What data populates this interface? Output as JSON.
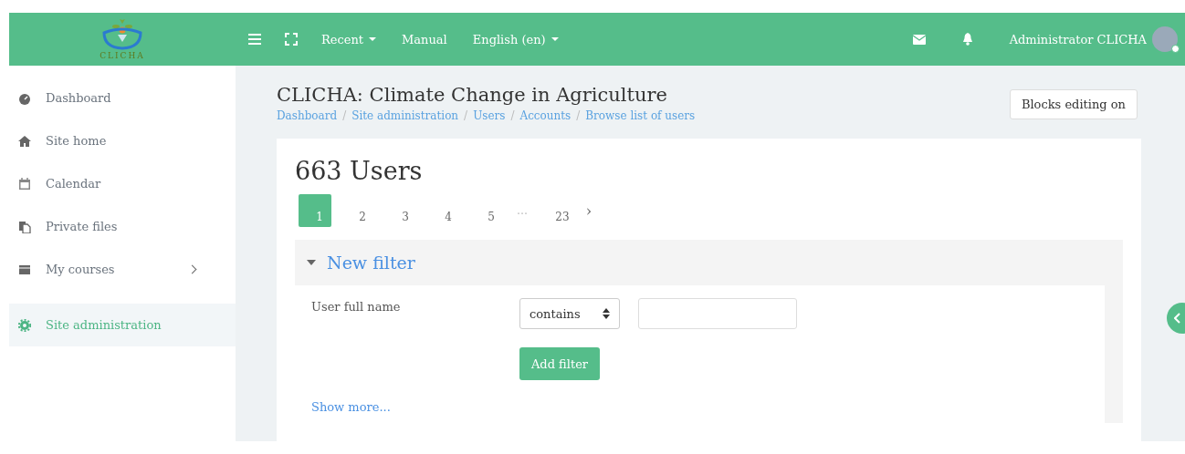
{
  "navbar": {
    "logo_text": "CLICHA",
    "menu": [
      {
        "label": "Recent",
        "dropdown": true
      },
      {
        "label": "Manual",
        "dropdown": false
      },
      {
        "label": "English (en)",
        "dropdown": true
      }
    ],
    "user_name": "Administrator CLICHA"
  },
  "sidebar": {
    "items": [
      {
        "label": "Dashboard",
        "kind": "dashboard",
        "selected": false,
        "has_children": false
      },
      {
        "label": "Site home",
        "kind": "home",
        "selected": false,
        "has_children": false
      },
      {
        "label": "Calendar",
        "kind": "calendar",
        "selected": false,
        "has_children": false
      },
      {
        "label": "Private files",
        "kind": "files",
        "selected": false,
        "has_children": false
      },
      {
        "label": "My courses",
        "kind": "courses",
        "selected": false,
        "has_children": true
      }
    ],
    "admin_items": [
      {
        "label": "Site administration",
        "kind": "settings",
        "selected": true,
        "has_children": false
      }
    ]
  },
  "header": {
    "title": "CLICHA: Climate Change in Agriculture",
    "breadcrumb": [
      {
        "label": "Dashboard"
      },
      {
        "separator": "/",
        "label": "Site administration"
      },
      {
        "separator": "/",
        "label": "Users"
      },
      {
        "separator": "/",
        "label": "Accounts"
      },
      {
        "separator": "/",
        "label": "Browse list of users"
      }
    ],
    "button": "Blocks editing on"
  },
  "content": {
    "heading": "663 Users",
    "pagination": [
      {
        "label": "1",
        "selected": true
      },
      {
        "label": "2",
        "selected": false
      },
      {
        "label": "3",
        "selected": false
      },
      {
        "label": "4",
        "selected": false
      },
      {
        "label": "5",
        "selected": false
      },
      {
        "label": "…",
        "selected": false,
        "kind": "gap"
      },
      {
        "label": "23",
        "selected": false
      },
      {
        "label": "›",
        "selected": false,
        "kind": "next"
      }
    ],
    "filter": {
      "title": "New filter",
      "expanded": true,
      "field_label": "User full name",
      "operator": "contains",
      "add_button": "Add filter",
      "show_more": "Show more..."
    }
  }
}
